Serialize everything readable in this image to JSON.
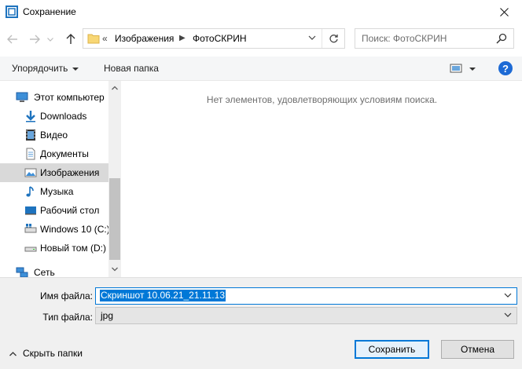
{
  "window": {
    "title": "Сохранение",
    "icon": "save-dialog-icon"
  },
  "address_bar": {
    "overflow": "«",
    "crumbs": [
      "Изображения",
      "ФотоСКРИН"
    ]
  },
  "search": {
    "placeholder": "Поиск: ФотоСКРИН"
  },
  "toolbar": {
    "organize_label": "Упорядочить",
    "new_folder_label": "Новая папка",
    "help_label": "?"
  },
  "nav": {
    "items": [
      {
        "label": "Этот компьютер",
        "icon": "computer-icon"
      },
      {
        "label": "Downloads",
        "icon": "download-arrow-icon"
      },
      {
        "label": "Видео",
        "icon": "video-icon"
      },
      {
        "label": "Документы",
        "icon": "documents-icon"
      },
      {
        "label": "Изображения",
        "icon": "pictures-icon",
        "selected": true
      },
      {
        "label": "Музыка",
        "icon": "music-icon"
      },
      {
        "label": "Рабочий стол",
        "icon": "desktop-icon"
      },
      {
        "label": "Windows 10 (C:)",
        "icon": "system-drive-icon"
      },
      {
        "label": "Новый том (D:)",
        "icon": "drive-icon"
      },
      {
        "label": "Сеть",
        "icon": "network-icon"
      }
    ]
  },
  "content": {
    "empty_message": "Нет элементов, удовлетворяющих условиям поиска."
  },
  "form": {
    "filename_label": "Имя файла:",
    "filename_value": "Скриншот 10.06.21_21.11.13",
    "filetype_label": "Тип файла:",
    "filetype_value": "jpg"
  },
  "footer": {
    "hide_folders_label": "Скрыть папки",
    "save_label": "Сохранить",
    "cancel_label": "Отмена"
  },
  "colors": {
    "accent": "#0078d7",
    "selection": "#d9d9d9",
    "help": "#1d6ad5"
  }
}
